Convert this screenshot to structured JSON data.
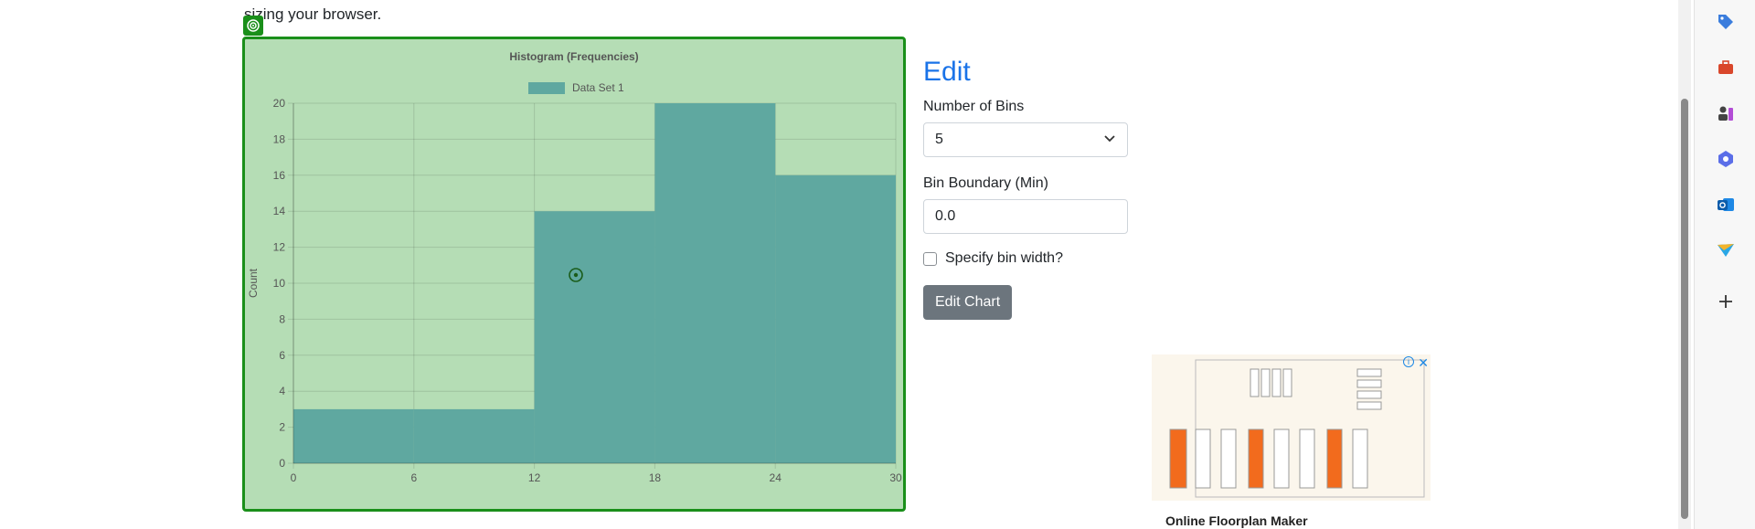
{
  "page": {
    "intro_tail": "sizing your browser."
  },
  "chart_data": {
    "type": "bar",
    "title": "Histogram (Frequencies)",
    "legend": [
      "Data Set 1"
    ],
    "xlabel": "",
    "ylabel": "Count",
    "x_ticks": [
      "0",
      "6",
      "12",
      "18",
      "24",
      "30"
    ],
    "y_ticks": [
      "0",
      "2",
      "4",
      "6",
      "8",
      "10",
      "12",
      "14",
      "16",
      "18",
      "20"
    ],
    "bins": [
      {
        "start": 0,
        "end": 6,
        "value": 3
      },
      {
        "start": 6,
        "end": 12,
        "value": 3
      },
      {
        "start": 12,
        "end": 18,
        "value": 14
      },
      {
        "start": 18,
        "end": 24,
        "value": 20
      },
      {
        "start": 24,
        "end": 30,
        "value": 16
      }
    ],
    "xlim": [
      0,
      30
    ],
    "ylim": [
      0,
      20
    ],
    "grid": true,
    "legend_position": "top-center",
    "colors": {
      "bar": "#5fa8a0",
      "background": "#b5ddb5",
      "border": "#1a8f1a"
    }
  },
  "edit": {
    "title": "Edit",
    "bins_label": "Number of Bins",
    "bins_value": "5",
    "min_label": "Bin Boundary (Min)",
    "min_value": "0.0",
    "width_checkbox_label": "Specify bin width?",
    "submit_label": "Edit Chart"
  },
  "ad": {
    "title": "Online Floorplan Maker",
    "close": "✕",
    "info": "i"
  },
  "rail_icons": [
    "tag-icon",
    "toolbox-icon",
    "chess-icon",
    "copilot-icon",
    "outlook-icon",
    "send-icon",
    "plus-icon"
  ]
}
